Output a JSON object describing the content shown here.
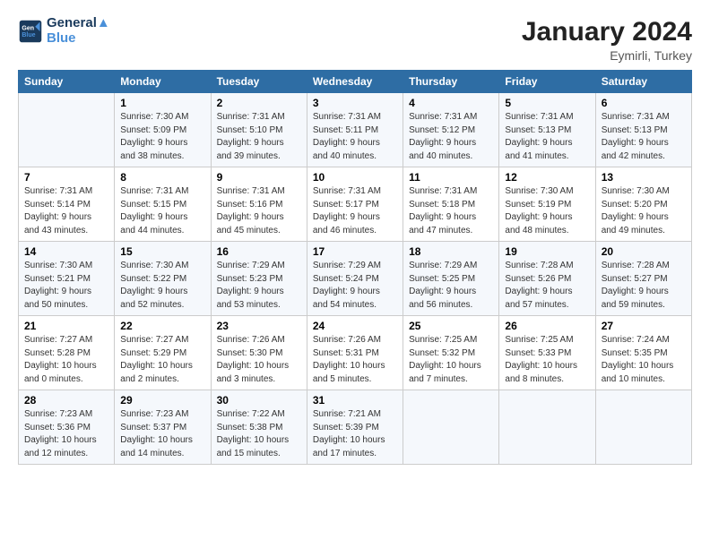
{
  "header": {
    "logo_line1": "General",
    "logo_line2": "Blue",
    "main_title": "January 2024",
    "subtitle": "Eymirli, Turkey"
  },
  "days_of_week": [
    "Sunday",
    "Monday",
    "Tuesday",
    "Wednesday",
    "Thursday",
    "Friday",
    "Saturday"
  ],
  "weeks": [
    [
      {
        "num": "",
        "info": ""
      },
      {
        "num": "1",
        "info": "Sunrise: 7:30 AM\nSunset: 5:09 PM\nDaylight: 9 hours\nand 38 minutes."
      },
      {
        "num": "2",
        "info": "Sunrise: 7:31 AM\nSunset: 5:10 PM\nDaylight: 9 hours\nand 39 minutes."
      },
      {
        "num": "3",
        "info": "Sunrise: 7:31 AM\nSunset: 5:11 PM\nDaylight: 9 hours\nand 40 minutes."
      },
      {
        "num": "4",
        "info": "Sunrise: 7:31 AM\nSunset: 5:12 PM\nDaylight: 9 hours\nand 40 minutes."
      },
      {
        "num": "5",
        "info": "Sunrise: 7:31 AM\nSunset: 5:13 PM\nDaylight: 9 hours\nand 41 minutes."
      },
      {
        "num": "6",
        "info": "Sunrise: 7:31 AM\nSunset: 5:13 PM\nDaylight: 9 hours\nand 42 minutes."
      }
    ],
    [
      {
        "num": "7",
        "info": "Sunrise: 7:31 AM\nSunset: 5:14 PM\nDaylight: 9 hours\nand 43 minutes."
      },
      {
        "num": "8",
        "info": "Sunrise: 7:31 AM\nSunset: 5:15 PM\nDaylight: 9 hours\nand 44 minutes."
      },
      {
        "num": "9",
        "info": "Sunrise: 7:31 AM\nSunset: 5:16 PM\nDaylight: 9 hours\nand 45 minutes."
      },
      {
        "num": "10",
        "info": "Sunrise: 7:31 AM\nSunset: 5:17 PM\nDaylight: 9 hours\nand 46 minutes."
      },
      {
        "num": "11",
        "info": "Sunrise: 7:31 AM\nSunset: 5:18 PM\nDaylight: 9 hours\nand 47 minutes."
      },
      {
        "num": "12",
        "info": "Sunrise: 7:30 AM\nSunset: 5:19 PM\nDaylight: 9 hours\nand 48 minutes."
      },
      {
        "num": "13",
        "info": "Sunrise: 7:30 AM\nSunset: 5:20 PM\nDaylight: 9 hours\nand 49 minutes."
      }
    ],
    [
      {
        "num": "14",
        "info": "Sunrise: 7:30 AM\nSunset: 5:21 PM\nDaylight: 9 hours\nand 50 minutes."
      },
      {
        "num": "15",
        "info": "Sunrise: 7:30 AM\nSunset: 5:22 PM\nDaylight: 9 hours\nand 52 minutes."
      },
      {
        "num": "16",
        "info": "Sunrise: 7:29 AM\nSunset: 5:23 PM\nDaylight: 9 hours\nand 53 minutes."
      },
      {
        "num": "17",
        "info": "Sunrise: 7:29 AM\nSunset: 5:24 PM\nDaylight: 9 hours\nand 54 minutes."
      },
      {
        "num": "18",
        "info": "Sunrise: 7:29 AM\nSunset: 5:25 PM\nDaylight: 9 hours\nand 56 minutes."
      },
      {
        "num": "19",
        "info": "Sunrise: 7:28 AM\nSunset: 5:26 PM\nDaylight: 9 hours\nand 57 minutes."
      },
      {
        "num": "20",
        "info": "Sunrise: 7:28 AM\nSunset: 5:27 PM\nDaylight: 9 hours\nand 59 minutes."
      }
    ],
    [
      {
        "num": "21",
        "info": "Sunrise: 7:27 AM\nSunset: 5:28 PM\nDaylight: 10 hours\nand 0 minutes."
      },
      {
        "num": "22",
        "info": "Sunrise: 7:27 AM\nSunset: 5:29 PM\nDaylight: 10 hours\nand 2 minutes."
      },
      {
        "num": "23",
        "info": "Sunrise: 7:26 AM\nSunset: 5:30 PM\nDaylight: 10 hours\nand 3 minutes."
      },
      {
        "num": "24",
        "info": "Sunrise: 7:26 AM\nSunset: 5:31 PM\nDaylight: 10 hours\nand 5 minutes."
      },
      {
        "num": "25",
        "info": "Sunrise: 7:25 AM\nSunset: 5:32 PM\nDaylight: 10 hours\nand 7 minutes."
      },
      {
        "num": "26",
        "info": "Sunrise: 7:25 AM\nSunset: 5:33 PM\nDaylight: 10 hours\nand 8 minutes."
      },
      {
        "num": "27",
        "info": "Sunrise: 7:24 AM\nSunset: 5:35 PM\nDaylight: 10 hours\nand 10 minutes."
      }
    ],
    [
      {
        "num": "28",
        "info": "Sunrise: 7:23 AM\nSunset: 5:36 PM\nDaylight: 10 hours\nand 12 minutes."
      },
      {
        "num": "29",
        "info": "Sunrise: 7:23 AM\nSunset: 5:37 PM\nDaylight: 10 hours\nand 14 minutes."
      },
      {
        "num": "30",
        "info": "Sunrise: 7:22 AM\nSunset: 5:38 PM\nDaylight: 10 hours\nand 15 minutes."
      },
      {
        "num": "31",
        "info": "Sunrise: 7:21 AM\nSunset: 5:39 PM\nDaylight: 10 hours\nand 17 minutes."
      },
      {
        "num": "",
        "info": ""
      },
      {
        "num": "",
        "info": ""
      },
      {
        "num": "",
        "info": ""
      }
    ]
  ]
}
